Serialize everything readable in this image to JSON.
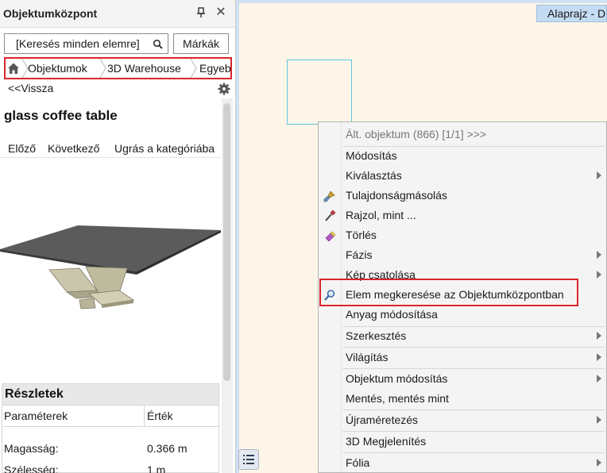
{
  "panel": {
    "title": "Objektumközpont",
    "search_value": "[Keresés minden elemre]",
    "brands_label": "Márkák",
    "breadcrumb": [
      "Objektumok",
      "3D Warehouse",
      "Egyeb"
    ],
    "back_label": "<<Vissza",
    "item_title": "glass coffee table",
    "nav": {
      "prev": "Előző",
      "next": "Következő",
      "goto": "Ugrás a kategóriába"
    },
    "details": {
      "title": "Részletek",
      "col_param": "Paraméterek",
      "col_value": "Érték",
      "rows": [
        {
          "name": "Magasság:",
          "value": "0.366 m"
        },
        {
          "name": "Szélesség:",
          "value": "1 m"
        }
      ]
    }
  },
  "canvas": {
    "tab_label": "Alaprajz - D",
    "background": "#fdf5e8"
  },
  "context_menu": {
    "header": "Ált. objektum (866) [1/1] >>>",
    "items": [
      {
        "label": "Módosítás",
        "submenu": false,
        "icon": null
      },
      {
        "label": "Kiválasztás",
        "submenu": true,
        "icon": null
      },
      {
        "label": "Tulajdonságmásolás",
        "submenu": false,
        "icon": "brush-icon"
      },
      {
        "label": "Rajzol, mint ...",
        "submenu": false,
        "icon": "eyedropper-icon"
      },
      {
        "label": "Törlés",
        "submenu": false,
        "icon": "eraser-icon"
      },
      {
        "label": "Fázis",
        "submenu": true,
        "icon": null
      },
      {
        "label": "Kép csatolása",
        "submenu": true,
        "icon": null
      },
      {
        "label": "Elem megkeresése az Objektumközpontban",
        "submenu": false,
        "icon": "find-object-icon"
      },
      {
        "label": "Anyag módosítása",
        "submenu": false,
        "icon": null
      },
      {
        "label": "Szerkesztés",
        "submenu": true,
        "icon": null
      },
      {
        "label": "Világítás",
        "submenu": true,
        "icon": null
      },
      {
        "label": "Objektum módosítás",
        "submenu": true,
        "icon": null
      },
      {
        "label": "Mentés, mentés mint",
        "submenu": false,
        "icon": null
      },
      {
        "label": "Újraméretezés",
        "submenu": true,
        "icon": null
      },
      {
        "label": "3D Megjelenítés",
        "submenu": false,
        "icon": null
      },
      {
        "label": "Fólia",
        "submenu": true,
        "icon": null
      }
    ]
  },
  "colors": {
    "highlight_border": "#d9252b",
    "selection": "#61c6dc",
    "tab_bg": "#c4dcf3"
  }
}
